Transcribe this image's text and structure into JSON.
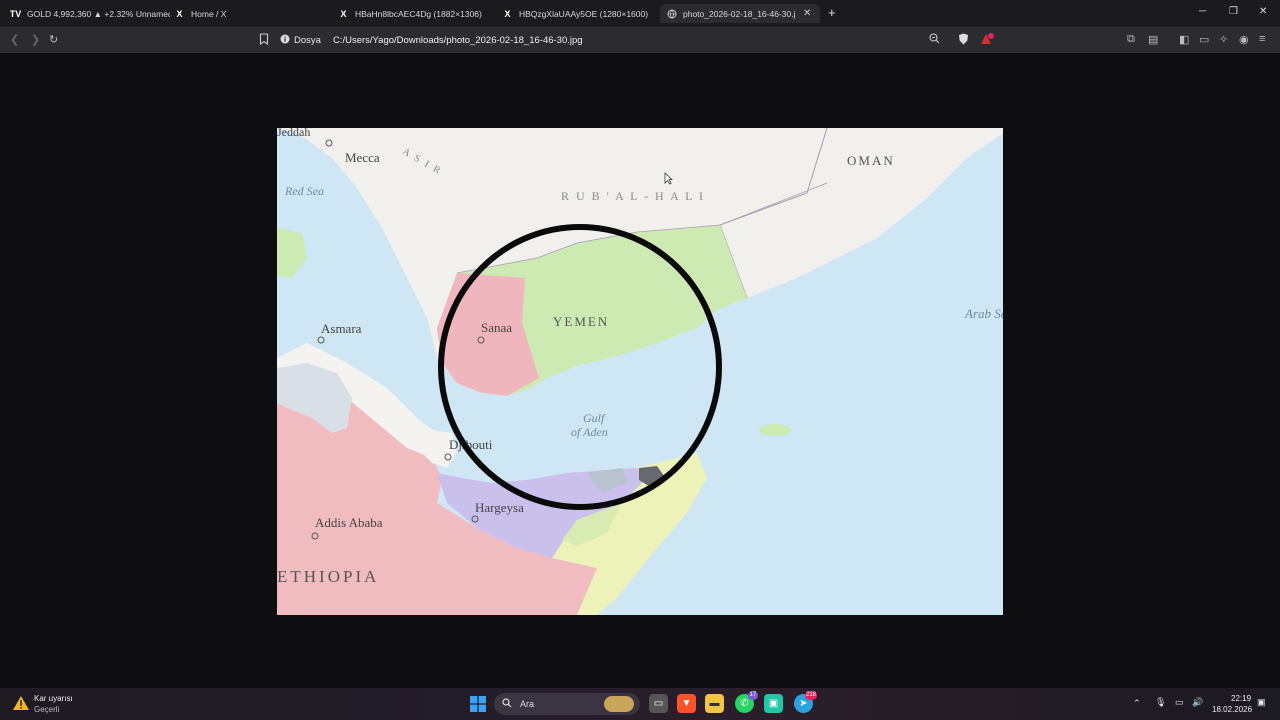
{
  "tabs": [
    {
      "label": "GOLD 4,992,360 ▲ +2.32% Unnamed",
      "icon": "tradingview-icon",
      "active": false
    },
    {
      "label": "Home / X",
      "icon": "x-icon",
      "active": false
    },
    {
      "label": "HBaHn8lbcAEC4Dg (1882×1306)",
      "icon": "x-icon",
      "active": false
    },
    {
      "label": "HBQzgXlaUAAy5OE (1280×1600)",
      "icon": "x-icon",
      "active": false
    },
    {
      "label": "photo_2026-02-18_16-46-30.jpg",
      "icon": "globe-icon",
      "active": true
    }
  ],
  "address": {
    "scheme_label": "Dosya",
    "path": "C:/Users/Yago/Downloads/photo_2026-02-18_16-46-30.jpg"
  },
  "map": {
    "labels": {
      "jeddah": "Jeddah",
      "mecca": "Mecca",
      "asir": "A S I R",
      "red_sea": "Red Sea",
      "rub_al_khali": "R U B ' A L - H A L I",
      "oman": "OMAN",
      "asmara": "Asmara",
      "sanaa": "Sanaa",
      "yemen": "YEMEN",
      "arabian_sea": "Arab Se",
      "gulf_of_aden_1": "Gulf",
      "gulf_of_aden_2": "of Aden",
      "djibouti": "Djibouti",
      "hargeysa": "Hargeysa",
      "addis_ababa": "Addis Ababa",
      "ethiopia": "ETHIOPIA"
    },
    "colors": {
      "land": "#f2f0ec",
      "sea": "#cfe6f4",
      "yemen": "#cdeab3",
      "sanaa_region": "#efb7bd",
      "ethiopia": "#f0bcc0",
      "somaliland": "#c9c1ec",
      "somalia": "#ecf2b8",
      "eritrea": "#f5f3ef"
    }
  },
  "taskbar": {
    "weather_title": "Kar uyarısı",
    "weather_sub": "Geçerli",
    "search_label": "Ara",
    "time": "22:19",
    "date": "18.02.2026",
    "whatsapp_badge": "17",
    "telegram_badge": "218"
  }
}
